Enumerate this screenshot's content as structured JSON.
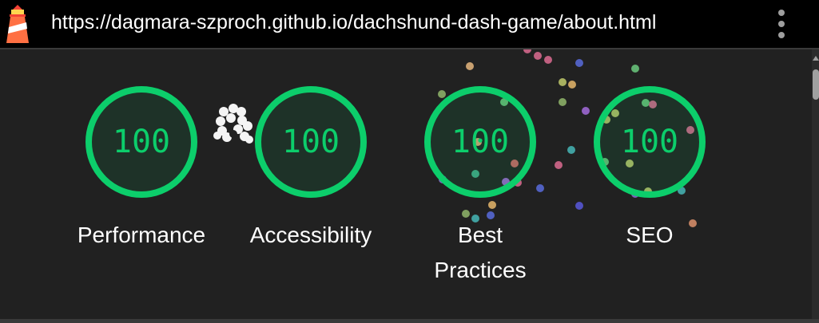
{
  "address_bar": {
    "logo_icon": "lighthouse-icon",
    "url": "https://dagmara-szproch.github.io/dachshund-dash-game/about.html",
    "menu_icon": "kebab-menu-icon"
  },
  "scores": [
    {
      "label": "Performance",
      "score": "100"
    },
    {
      "label": "Accessibility",
      "score": "100"
    },
    {
      "label": "Best Practices",
      "score": "100"
    },
    {
      "label": "SEO",
      "score": "100"
    }
  ],
  "colors": {
    "pass_green": "#0cce6b",
    "background": "#212121",
    "topbar": "#000000"
  }
}
